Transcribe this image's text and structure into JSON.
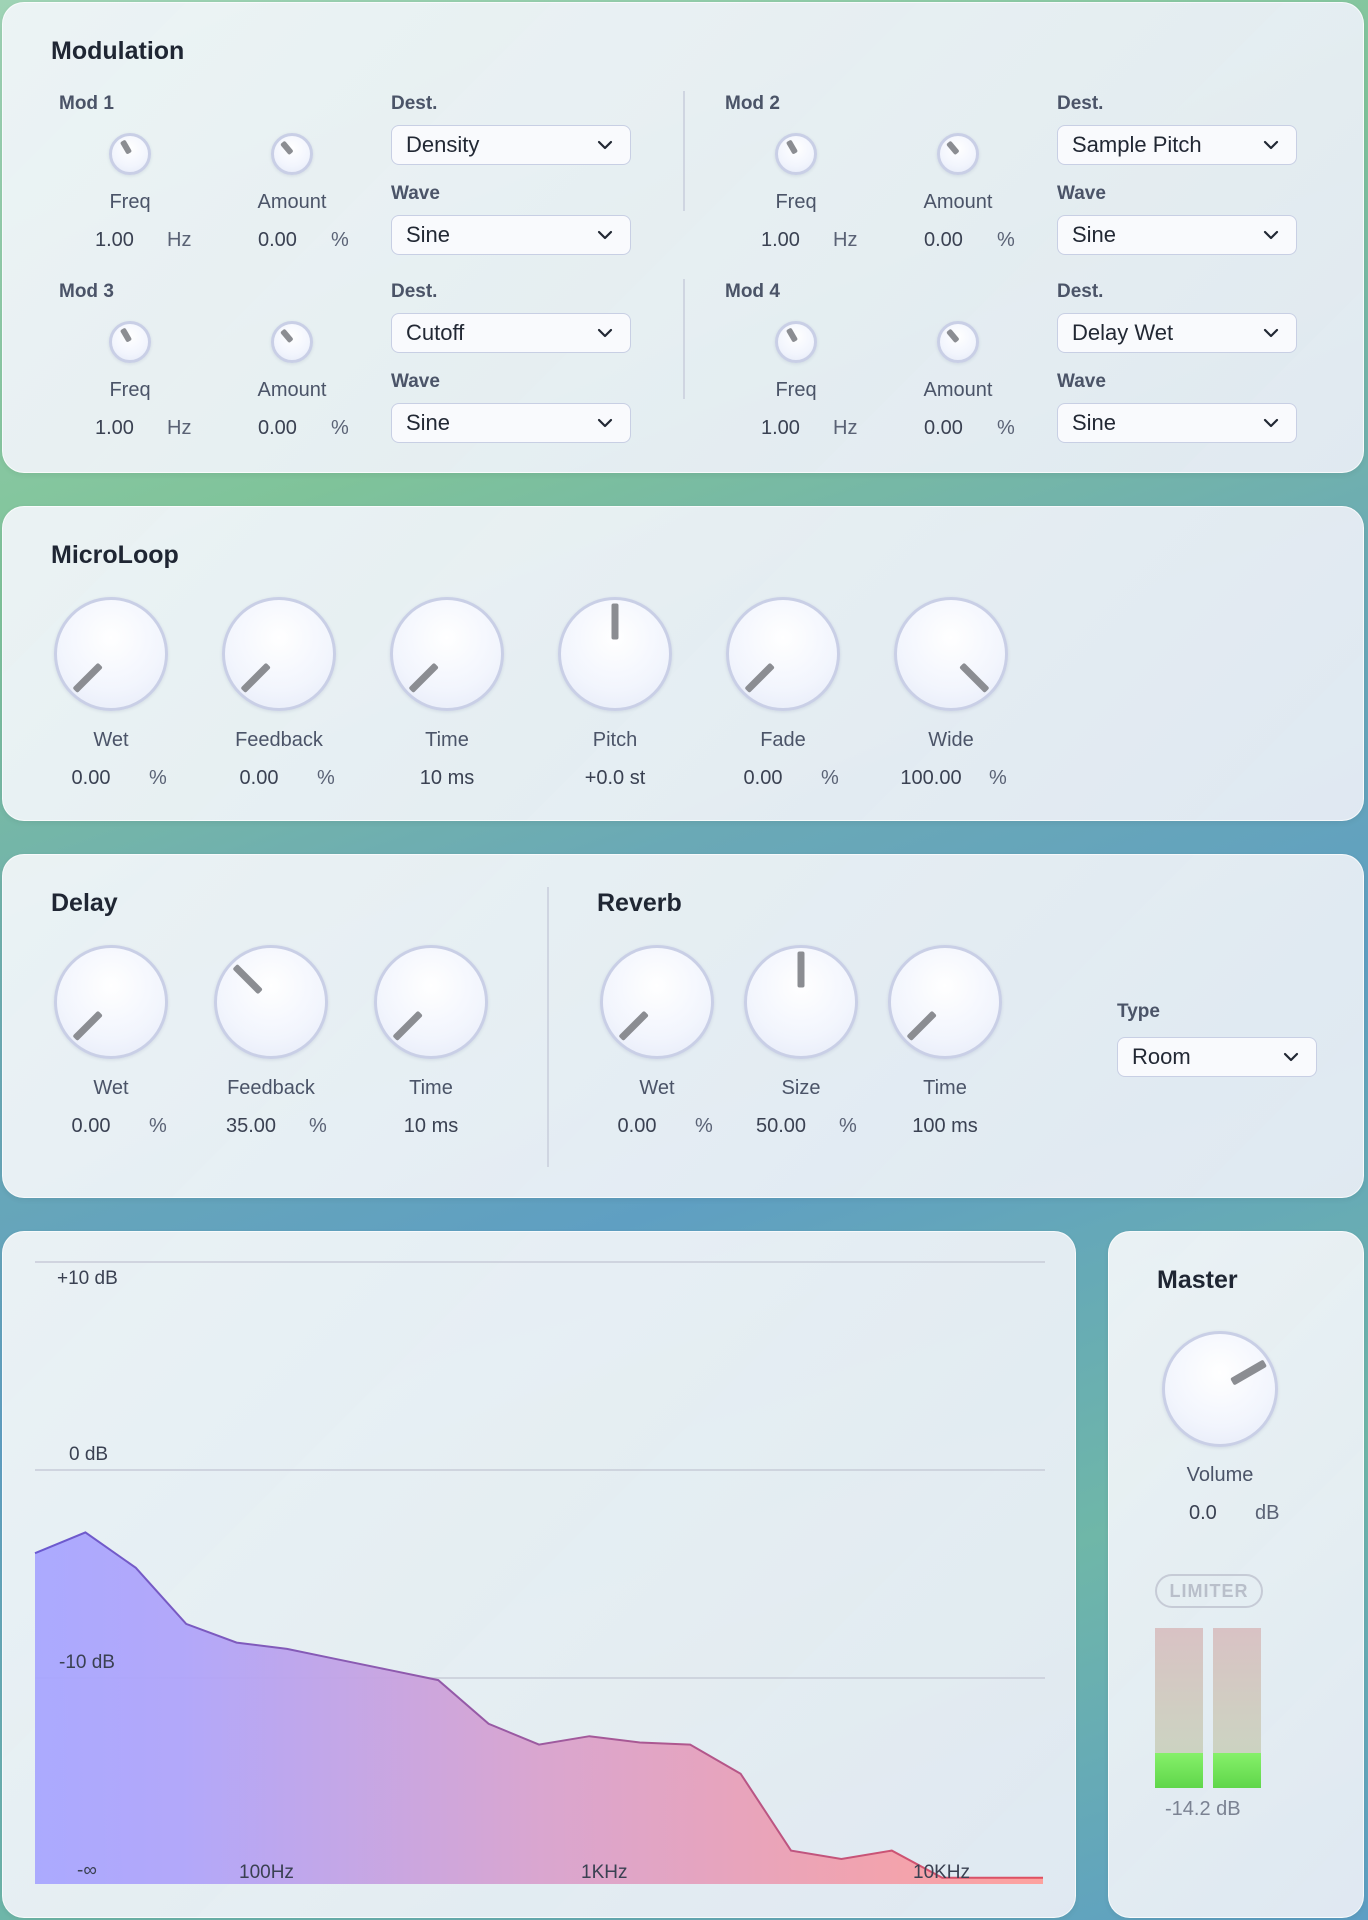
{
  "modulation": {
    "title": "Modulation",
    "mods": [
      {
        "name": "Mod 1",
        "freq_label": "Freq",
        "freq": "1.00",
        "freq_unit": "Hz",
        "amount_label": "Amount",
        "amount": "0.00",
        "amount_unit": "%",
        "dest_label": "Dest.",
        "dest": "Density",
        "wave_label": "Wave",
        "wave": "Sine"
      },
      {
        "name": "Mod 2",
        "freq_label": "Freq",
        "freq": "1.00",
        "freq_unit": "Hz",
        "amount_label": "Amount",
        "amount": "0.00",
        "amount_unit": "%",
        "dest_label": "Dest.",
        "dest": "Sample Pitch",
        "wave_label": "Wave",
        "wave": "Sine"
      },
      {
        "name": "Mod 3",
        "freq_label": "Freq",
        "freq": "1.00",
        "freq_unit": "Hz",
        "amount_label": "Amount",
        "amount": "0.00",
        "amount_unit": "%",
        "dest_label": "Dest.",
        "dest": "Cutoff",
        "wave_label": "Wave",
        "wave": "Sine"
      },
      {
        "name": "Mod 4",
        "freq_label": "Freq",
        "freq": "1.00",
        "freq_unit": "Hz",
        "amount_label": "Amount",
        "amount": "0.00",
        "amount_unit": "%",
        "dest_label": "Dest.",
        "dest": "Delay Wet",
        "wave_label": "Wave",
        "wave": "Sine"
      }
    ]
  },
  "microloop": {
    "title": "MicroLoop",
    "knobs": [
      {
        "label": "Wet",
        "value": "0.00",
        "unit": "%"
      },
      {
        "label": "Feedback",
        "value": "0.00",
        "unit": "%"
      },
      {
        "label": "Time",
        "value": "10 ms",
        "unit": ""
      },
      {
        "label": "Pitch",
        "value": "+0.0 st",
        "unit": ""
      },
      {
        "label": "Fade",
        "value": "0.00",
        "unit": "%"
      },
      {
        "label": "Wide",
        "value": "100.00",
        "unit": "%"
      }
    ]
  },
  "delay": {
    "title": "Delay",
    "knobs": [
      {
        "label": "Wet",
        "value": "0.00",
        "unit": "%"
      },
      {
        "label": "Feedback",
        "value": "35.00",
        "unit": "%"
      },
      {
        "label": "Time",
        "value": "10 ms",
        "unit": ""
      }
    ]
  },
  "reverb": {
    "title": "Reverb",
    "knobs": [
      {
        "label": "Wet",
        "value": "0.00",
        "unit": "%"
      },
      {
        "label": "Size",
        "value": "50.00",
        "unit": "%"
      },
      {
        "label": "Time",
        "value": "100 ms",
        "unit": ""
      }
    ],
    "type_label": "Type",
    "type": "Room"
  },
  "spectrum": {
    "db_labels": [
      "+10 dB",
      "0 dB",
      "-10 dB",
      "-∞"
    ],
    "freq_labels": [
      "100Hz",
      "1KHz",
      "10KHz"
    ]
  },
  "master": {
    "title": "Master",
    "volume_label": "Volume",
    "volume": "0.0",
    "volume_unit": "dB",
    "limiter_label": "LIMITER",
    "meter_readout": "-14.2 dB",
    "meter_levels": [
      0.22,
      0.22
    ]
  },
  "chart_data": {
    "type": "area",
    "y_ticks": [
      "+10 dB",
      "0 dB",
      "-10 dB",
      "-∞"
    ],
    "x_ticks": [
      "100Hz",
      "1KHz",
      "10KHz"
    ],
    "points": [
      [
        0,
        -4
      ],
      [
        1,
        -3
      ],
      [
        2,
        -4.7
      ],
      [
        3,
        -7.4
      ],
      [
        4,
        -8.3
      ],
      [
        5,
        -8.6
      ],
      [
        6,
        -9.1
      ],
      [
        7,
        -9.6
      ],
      [
        8,
        -10.1
      ],
      [
        9,
        -12.2
      ],
      [
        10,
        -13.2
      ],
      [
        11,
        -12.8
      ],
      [
        12,
        -13.1
      ],
      [
        13,
        -13.2
      ],
      [
        14,
        -14.6
      ],
      [
        15,
        -18.3
      ],
      [
        16,
        -18.7
      ],
      [
        17,
        -18.3
      ],
      [
        18,
        -19.6
      ],
      [
        19,
        -19.6
      ],
      [
        20,
        -19.6
      ]
    ]
  }
}
